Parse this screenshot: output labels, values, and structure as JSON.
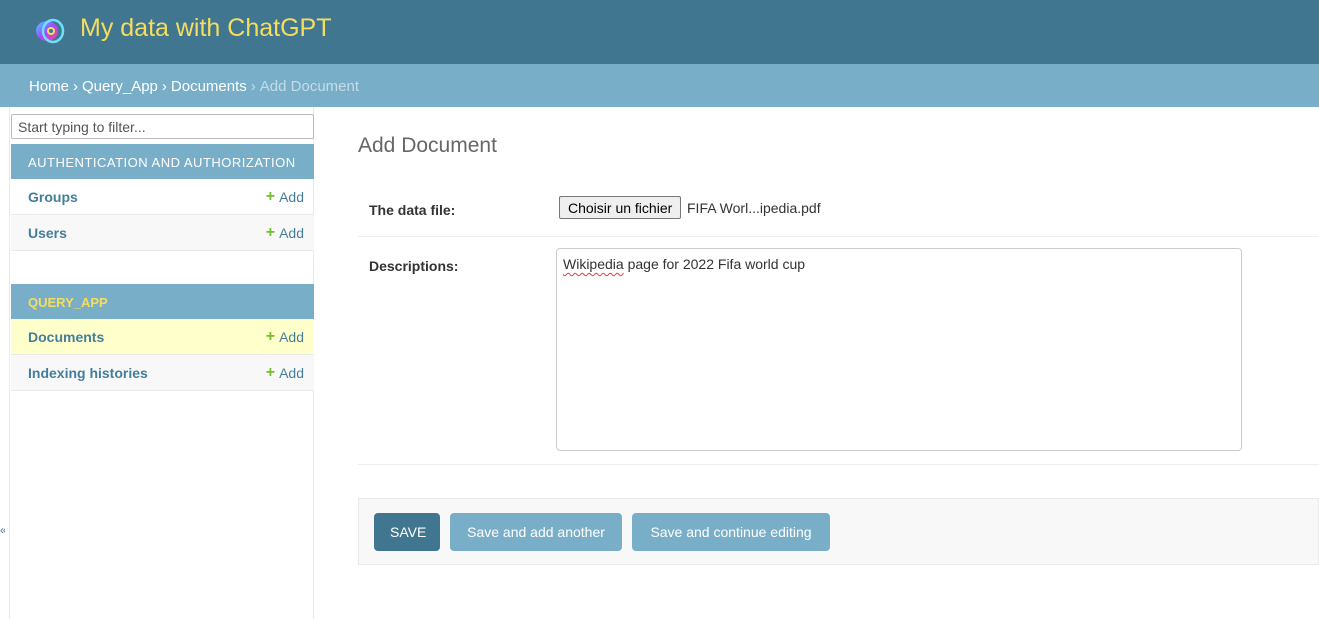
{
  "header": {
    "title": "My data with ChatGPT",
    "logo_icon": "chatgpt-logo-icon"
  },
  "breadcrumbs": {
    "items": [
      "Home",
      "Query_App",
      "Documents"
    ],
    "separator": "›",
    "current": "Add Document"
  },
  "sidebar": {
    "filter_placeholder": "Start typing to filter...",
    "modules": [
      {
        "caption": "AUTHENTICATION AND AUTHORIZATION",
        "models": [
          {
            "name": "Groups",
            "add_label": "Add"
          },
          {
            "name": "Users",
            "add_label": "Add"
          }
        ]
      },
      {
        "caption": "QUERY_APP",
        "models": [
          {
            "name": "Documents",
            "add_label": "Add",
            "current": true
          },
          {
            "name": "Indexing histories",
            "add_label": "Add"
          }
        ]
      }
    ],
    "toggle_label": "«"
  },
  "form": {
    "title": "Add Document",
    "data_file_label": "The data file:",
    "file_button_label": "Choisir un fichier",
    "file_name": "FIFA Worl...ipedia.pdf",
    "descriptions_label": "Descriptions:",
    "descriptions_value_misspelled": "Wikipedia",
    "descriptions_value_rest": " page for 2022 Fifa world cup"
  },
  "buttons": {
    "save": "SAVE",
    "save_add_another": "Save and add another",
    "save_continue": "Save and continue editing"
  },
  "colors": {
    "header_bg": "#417690",
    "brand_text": "#f5dd5d",
    "breadcrumb_bg": "#79aec8",
    "link": "#447e9b",
    "add_plus": "#70bf2b",
    "current_row": "#ffffcc"
  }
}
